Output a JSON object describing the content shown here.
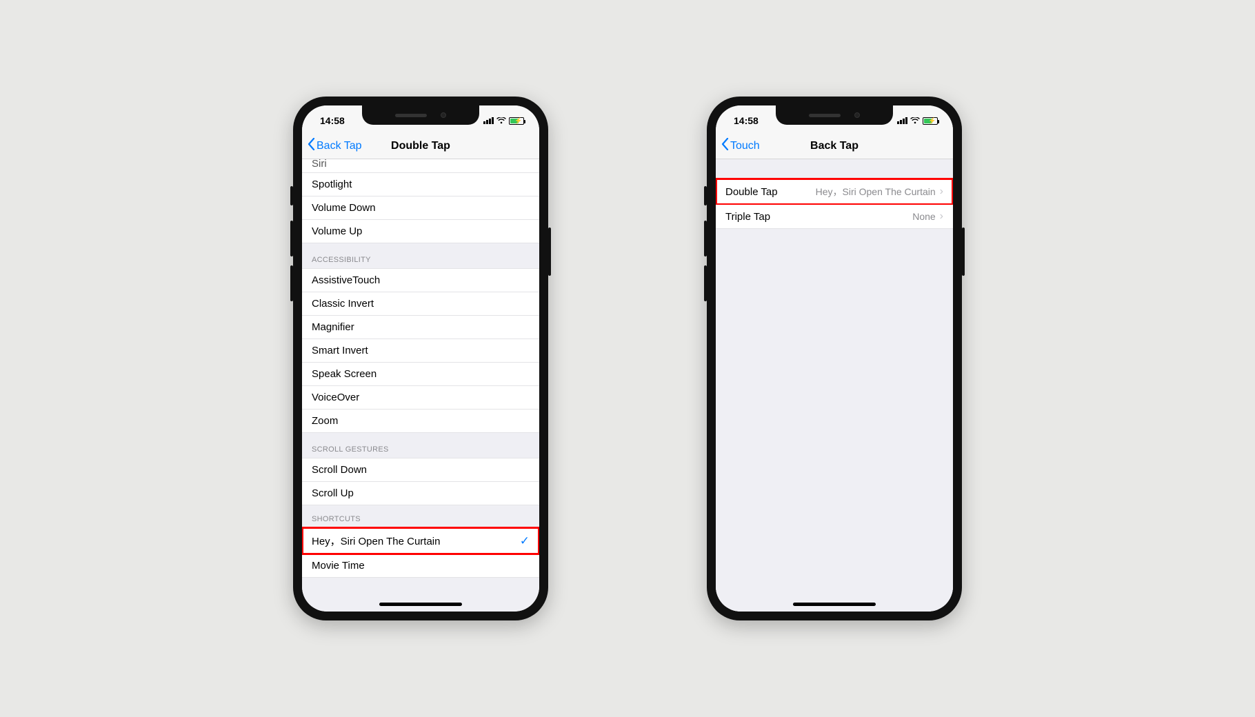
{
  "status": {
    "time": "14:58"
  },
  "phone1": {
    "nav": {
      "back": "Back Tap",
      "title": "Double Tap"
    },
    "top_partial": "Siri",
    "group0_items": [
      "Spotlight",
      "Volume Down",
      "Volume Up"
    ],
    "group_accessibility": {
      "header": "Accessibility",
      "items": [
        "AssistiveTouch",
        "Classic Invert",
        "Magnifier",
        "Smart Invert",
        "Speak Screen",
        "VoiceOver",
        "Zoom"
      ]
    },
    "group_scroll": {
      "header": "Scroll Gestures",
      "items": [
        "Scroll Down",
        "Scroll Up"
      ]
    },
    "group_shortcuts": {
      "header": "Shortcuts",
      "items": [
        "Hey，Siri Open The Curtain",
        "Movie Time"
      ],
      "selected_index": 0
    }
  },
  "phone2": {
    "nav": {
      "back": "Touch",
      "title": "Back Tap"
    },
    "rows": [
      {
        "label": "Double Tap",
        "value": "Hey，Siri Open The Curtain",
        "highlight": true
      },
      {
        "label": "Triple Tap",
        "value": "None",
        "highlight": false
      }
    ]
  }
}
